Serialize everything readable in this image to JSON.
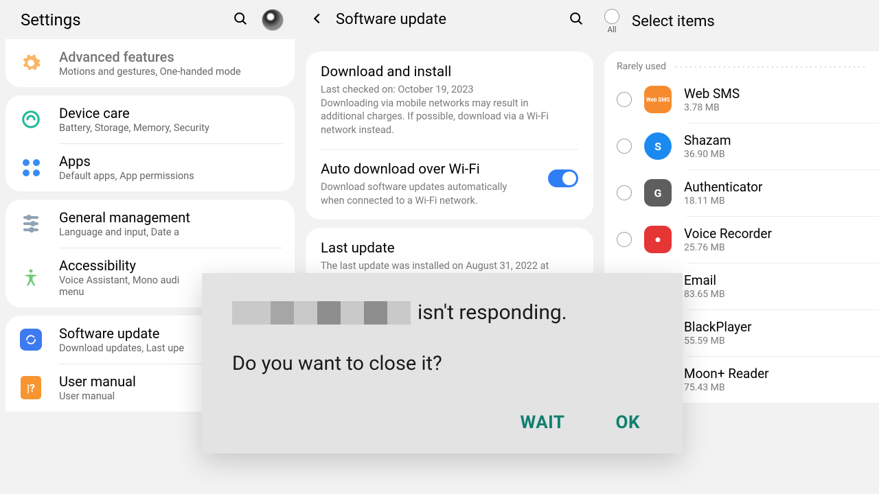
{
  "p1": {
    "title": "Settings",
    "items": [
      {
        "title": "Advanced features",
        "sub": "Motions and gestures, One-handed mode"
      },
      {
        "title": "Device care",
        "sub": "Battery, Storage, Memory, Security"
      },
      {
        "title": "Apps",
        "sub": "Default apps, App permissions"
      },
      {
        "title": "General management",
        "sub": "Language and input, Date a"
      },
      {
        "title": "Accessibility",
        "sub": "Voice Assistant, Mono audi\nmenu"
      },
      {
        "title": "Software update",
        "sub": "Download updates, Last upe"
      },
      {
        "title": "User manual",
        "sub": "User manual"
      }
    ]
  },
  "p2": {
    "title": "Software update",
    "dl_title": "Download and install",
    "dl_sub": "Last checked on: October 19, 2023\nDownloading via mobile networks may result in additional charges. If possible, download via a Wi-Fi network instead.",
    "auto_title": "Auto download over Wi-Fi",
    "auto_sub": "Download software updates automatically when connected to a Wi-Fi network.",
    "last_title": "Last update",
    "last_sub": "The last update was installed on August 31, 2022 at"
  },
  "p3": {
    "title": "Select items",
    "all": "All",
    "section": "Rarely used",
    "apps": [
      {
        "name": "Web SMS",
        "size": "3.78 MB",
        "color": "#f58b2e",
        "label": "Web SMS",
        "icon": true
      },
      {
        "name": "Shazam",
        "size": "36.90 MB",
        "color": "#1a8af0",
        "label": "S",
        "icon": true
      },
      {
        "name": "Authenticator",
        "size": "18.11 MB",
        "color": "#5e5e5e",
        "label": "G",
        "icon": true
      },
      {
        "name": "Voice Recorder",
        "size": "25.76 MB",
        "color": "#e53535",
        "label": "●",
        "icon": true
      },
      {
        "name": "Email",
        "size": "83.65 MB",
        "icon": false
      },
      {
        "name": "BlackPlayer",
        "size": "55.59 MB",
        "icon": false
      },
      {
        "name": "Moon+ Reader",
        "size": "75.43 MB",
        "icon": false
      }
    ]
  },
  "dialog": {
    "suffix": " isn't responding.",
    "line2": "Do you want to close it?",
    "wait": "WAIT",
    "ok": "OK"
  }
}
